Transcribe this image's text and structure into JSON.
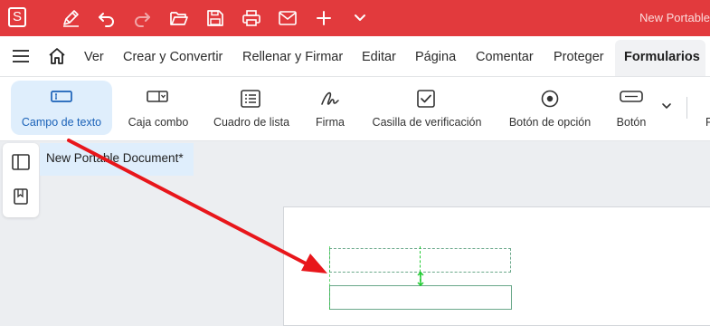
{
  "title_bar": {
    "app_logo": "S",
    "document_title": "New Portable"
  },
  "quick_access": [
    "pen-icon",
    "undo-icon",
    "redo-icon",
    "open-folder-icon",
    "save-icon",
    "print-icon",
    "email-icon",
    "add-icon",
    "chevron-down-icon"
  ],
  "menu": {
    "items": [
      "Ver",
      "Crear y Convertir",
      "Rellenar y Firmar",
      "Editar",
      "Página",
      "Comentar",
      "Proteger",
      "Formularios"
    ],
    "active": "Formularios"
  },
  "ribbon": {
    "buttons": [
      {
        "label": "Campo de texto",
        "icon": "text-field-icon",
        "selected": true
      },
      {
        "label": "Caja combo",
        "icon": "combo-box-icon"
      },
      {
        "label": "Cuadro de lista",
        "icon": "list-box-icon"
      },
      {
        "label": "Firma",
        "icon": "signature-icon"
      },
      {
        "label": "Casilla de verificación",
        "icon": "checkbox-icon"
      },
      {
        "label": "Botón de opción",
        "icon": "radio-button-icon"
      },
      {
        "label": "Botón",
        "icon": "button-icon"
      }
    ],
    "overflow_partial": "F"
  },
  "document_tab": {
    "label": "New Portable Document*"
  },
  "colors": {
    "brand_red": "#e23a3d",
    "selected_bg": "#dfeefc",
    "field_border": "#6aa88a",
    "guide_green": "#22cc33",
    "annotation_arrow": "#e8161b"
  }
}
